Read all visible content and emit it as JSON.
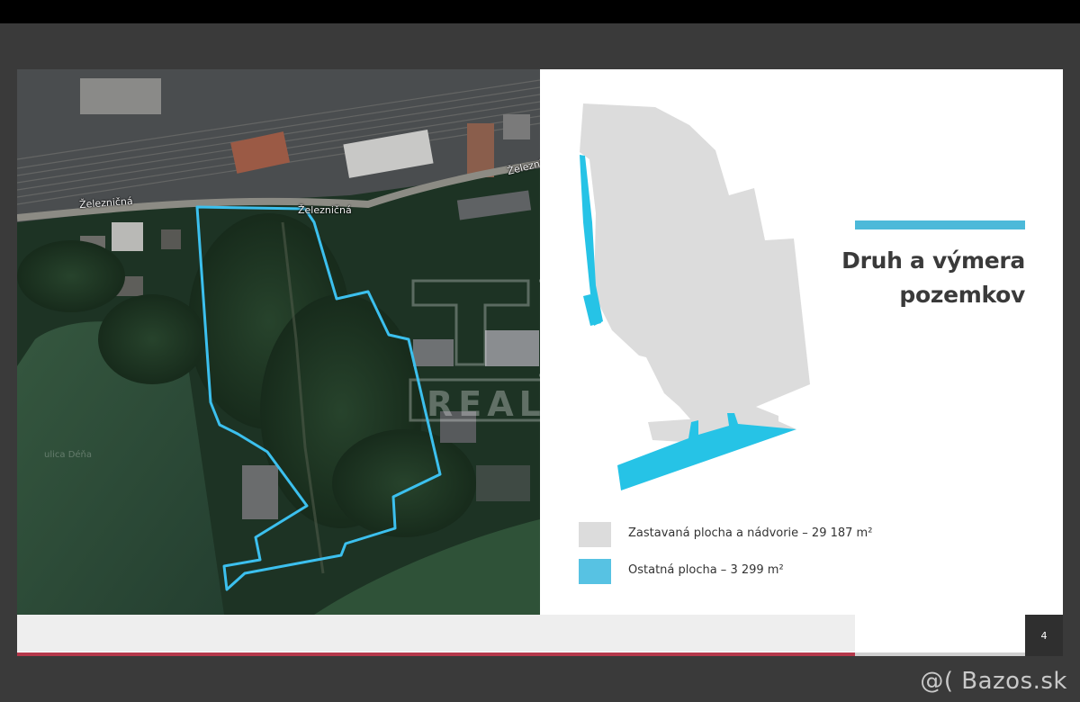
{
  "slide": {
    "title_line1": "Druh a výmera",
    "title_line2": "pozemkov",
    "page_number": "4"
  },
  "map": {
    "street_labels": [
      "Železničná",
      "Železničná",
      "Železničná"
    ],
    "watermark_text": "REAL",
    "field_label": "ulica Déňa",
    "boundary_color": "#3cc0ee"
  },
  "legend": [
    {
      "label": "Zastavaná plocha a nádvorie – 29 187 m²",
      "color": "#dcdcdc"
    },
    {
      "label": "Ostatná plocha – 3 299 m²",
      "color": "#57c2e3"
    }
  ],
  "watermark": {
    "text": "@( Bazos.sk"
  },
  "colors": {
    "parcel_gray": "#dcdcdc",
    "parcel_blue": "#26c3e6",
    "accent": "#4cb9d9",
    "footer_line": "#b5384b"
  }
}
